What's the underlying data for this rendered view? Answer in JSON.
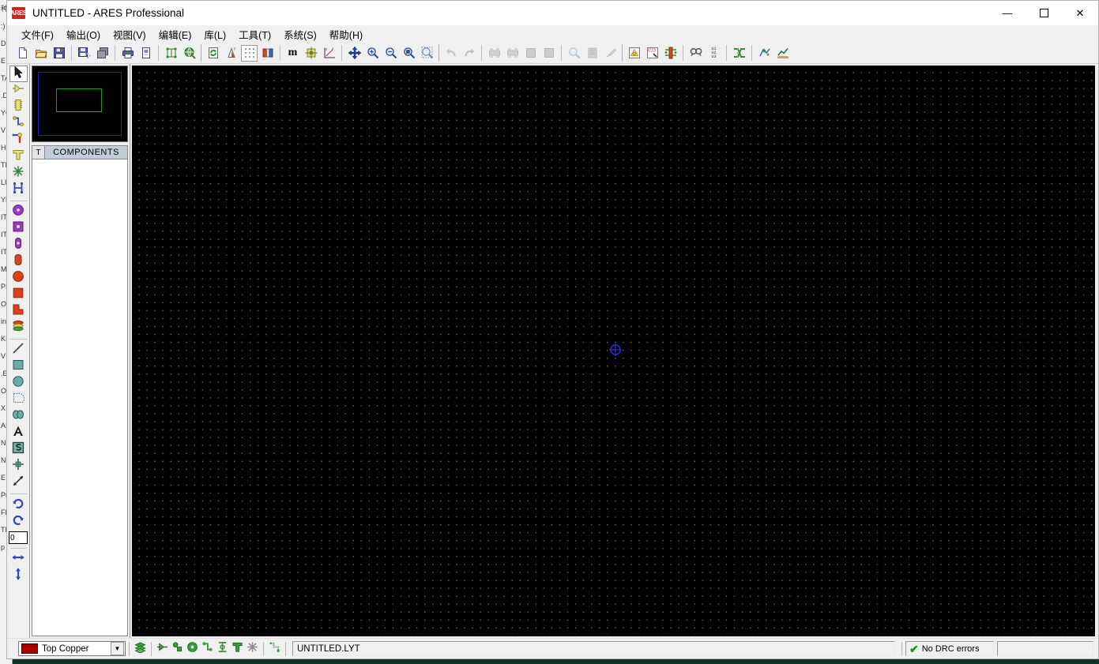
{
  "window": {
    "title": "UNTITLED - ARES Professional",
    "logo_text": "ARES",
    "logo_icon": "ares-logo-icon",
    "controls": {
      "minimize": "—",
      "maximize": "☐",
      "close": "✕"
    }
  },
  "menubar": {
    "items": [
      {
        "label": "文件(F)",
        "name": "menu-file"
      },
      {
        "label": "输出(O)",
        "name": "menu-output"
      },
      {
        "label": "视图(V)",
        "name": "menu-view"
      },
      {
        "label": "编辑(E)",
        "name": "menu-edit"
      },
      {
        "label": "库(L)",
        "name": "menu-library"
      },
      {
        "label": "工具(T)",
        "name": "menu-tools"
      },
      {
        "label": "系统(S)",
        "name": "menu-system"
      },
      {
        "label": "帮助(H)",
        "name": "menu-help"
      }
    ]
  },
  "toolbar": {
    "groups": [
      {
        "buttons": [
          {
            "icon": "new-file-icon",
            "title": "New Layout"
          },
          {
            "icon": "open-folder-icon",
            "title": "Open Layout"
          },
          {
            "icon": "save-icon",
            "title": "Save Layout"
          }
        ]
      },
      {
        "buttons": [
          {
            "icon": "import-region-icon",
            "title": "Import Region"
          },
          {
            "icon": "export-region-icon",
            "title": "Export Region"
          }
        ]
      },
      {
        "buttons": [
          {
            "icon": "print-icon",
            "title": "Print Layout"
          },
          {
            "icon": "print-region-icon",
            "title": "Print Region"
          }
        ]
      },
      {
        "buttons": [
          {
            "icon": "netlist-icon",
            "title": "Netlist Loader"
          },
          {
            "icon": "3d-visualizer-icon",
            "title": "3D Visualization"
          }
        ]
      },
      {
        "buttons": [
          {
            "icon": "refresh-icon",
            "title": "Redraw Display"
          },
          {
            "icon": "layer-select-icon",
            "title": "Toggle Layer Selector"
          },
          {
            "icon": "grid-dots-icon",
            "title": "Toggle Grid",
            "active": true
          },
          {
            "icon": "layers-icon",
            "title": "Layer Colours"
          }
        ]
      },
      {
        "buttons": [
          {
            "icon": "metric-icon",
            "title": "Toggle Metric/Imperial",
            "text": "m"
          },
          {
            "icon": "origin-icon",
            "title": "Set Origin"
          },
          {
            "icon": "xy-axis-icon",
            "title": "Set False Origin"
          }
        ]
      },
      {
        "buttons": [
          {
            "icon": "pan-icon",
            "title": "Pan"
          },
          {
            "icon": "zoom-in-icon",
            "title": "Zoom In"
          },
          {
            "icon": "zoom-out-icon",
            "title": "Zoom Out"
          },
          {
            "icon": "zoom-all-icon",
            "title": "Zoom All"
          },
          {
            "icon": "zoom-area-icon",
            "title": "Zoom to Area"
          }
        ]
      },
      {
        "buttons": [
          {
            "icon": "undo-icon",
            "title": "Undo",
            "disabled": true
          },
          {
            "icon": "redo-icon",
            "title": "Redo",
            "disabled": true
          }
        ]
      },
      {
        "buttons": [
          {
            "icon": "cut-icon",
            "title": "Cut to Clipboard",
            "disabled": true
          },
          {
            "icon": "copy-icon",
            "title": "Copy to Clipboard",
            "disabled": true
          },
          {
            "icon": "paste-icon",
            "title": "Paste from Clipboard",
            "disabled": true
          },
          {
            "icon": "block-copy-icon",
            "title": "Block Copy",
            "disabled": true
          }
        ]
      },
      {
        "buttons": [
          {
            "icon": "block-move-icon",
            "title": "Block Move",
            "disabled": true
          },
          {
            "icon": "block-rotate-icon",
            "title": "Block Rotate",
            "disabled": true
          },
          {
            "icon": "block-delete-icon",
            "title": "Block Delete",
            "disabled": true
          }
        ]
      },
      {
        "buttons": [
          {
            "icon": "autoplace-icon",
            "title": "Auto Placer"
          },
          {
            "icon": "autoroute-icon",
            "title": "Auto Router"
          },
          {
            "icon": "power-plane-icon",
            "title": "Power Plane Generator"
          }
        ]
      },
      {
        "buttons": [
          {
            "icon": "search-icon",
            "title": "Search and Tag"
          },
          {
            "icon": "auto-name-icon",
            "title": "Auto Name Generator"
          }
        ]
      },
      {
        "buttons": [
          {
            "icon": "netlist-compiler-icon",
            "title": "Netlist Compiler"
          }
        ]
      },
      {
        "buttons": [
          {
            "icon": "drc-icon",
            "title": "Design Rule Manager"
          },
          {
            "icon": "report-icon",
            "title": "Connectivity Report"
          }
        ]
      }
    ]
  },
  "tool_palette": {
    "tools": [
      {
        "name": "selection-tool",
        "icon": "arrow-cursor-icon",
        "selected": true
      },
      {
        "name": "component-tool",
        "icon": "component-arrow-icon"
      },
      {
        "name": "package-tool",
        "icon": "dip-package-icon"
      },
      {
        "name": "track-tool",
        "icon": "track-path-icon"
      },
      {
        "name": "via-tool",
        "icon": "via-pin-icon"
      },
      {
        "name": "zone-tool",
        "icon": "t-shape-icon"
      },
      {
        "name": "ratsnest-tool",
        "icon": "ratsnest-star-icon"
      },
      {
        "name": "connectivity-tool",
        "icon": "connectivity-h-icon"
      },
      {
        "sep": true
      },
      {
        "name": "round-through-pad-tool",
        "icon": "round-pad-icon"
      },
      {
        "name": "square-through-pad-tool",
        "icon": "square-pad-icon"
      },
      {
        "name": "dil-pad-tool",
        "icon": "dil-pad-icon"
      },
      {
        "name": "edge-pad-tool",
        "icon": "edge-pad-icon"
      },
      {
        "name": "smt-round-pad-tool",
        "icon": "smt-round-pad-icon"
      },
      {
        "name": "smt-square-pad-tool",
        "icon": "smt-square-pad-icon"
      },
      {
        "name": "smt-poly-pad-tool",
        "icon": "poly-pad-icon"
      },
      {
        "name": "pad-stack-tool",
        "icon": "pad-stack-icon"
      },
      {
        "sep": true
      },
      {
        "name": "line-tool",
        "icon": "line-icon"
      },
      {
        "name": "rectangle-tool",
        "icon": "rectangle-icon"
      },
      {
        "name": "circle-tool",
        "icon": "circle-icon"
      },
      {
        "name": "arc-tool",
        "icon": "arc-icon"
      },
      {
        "name": "path-tool",
        "icon": "closed-path-icon"
      },
      {
        "name": "text-tool",
        "icon": "text-a-icon"
      },
      {
        "name": "symbol-tool",
        "icon": "symbol-s-icon"
      },
      {
        "name": "marker-tool",
        "icon": "marker-cross-icon"
      },
      {
        "name": "dimension-tool",
        "icon": "dimension-arrow-icon"
      },
      {
        "sep": true
      },
      {
        "name": "rotate-clockwise",
        "icon": "rotate-cw-icon"
      },
      {
        "name": "rotate-anticlockwise",
        "icon": "rotate-ccw-icon"
      },
      {
        "name": "rotation-value-input",
        "icon": "rotation-field",
        "value": "0"
      },
      {
        "sep": true
      },
      {
        "name": "mirror-horizontal",
        "icon": "flip-horizontal-icon"
      },
      {
        "name": "mirror-vertical",
        "icon": "flip-vertical-icon"
      }
    ],
    "rotation_value": "0"
  },
  "left_panel": {
    "preview": {
      "name": "component-preview",
      "board_outline_color": "#2222bb",
      "part_outline_color": "#23a023",
      "background_color": "#000000"
    },
    "components_header": {
      "toggle_label": "T",
      "title": "COMPONENTS"
    },
    "components_list": []
  },
  "canvas": {
    "background_color": "#000000",
    "grid_dot_color": "#787878",
    "origin_marker_color": "#2222cc",
    "origin_icon": "origin-crosshair-icon"
  },
  "statusbar": {
    "layer": {
      "name": "Top Copper",
      "color": "#aa0000",
      "arrow": "▼"
    },
    "buttons": [
      {
        "name": "layer-stack-button",
        "icon": "layer-stack-icon"
      },
      {
        "sep": true
      },
      {
        "name": "display-components-button",
        "icon": "display-component-icon"
      },
      {
        "name": "display-pads-button",
        "icon": "display-pads-icon"
      },
      {
        "name": "display-vias-button",
        "icon": "display-via-icon"
      },
      {
        "name": "display-tracks-button",
        "icon": "display-track-icon"
      },
      {
        "name": "display-zones-button",
        "icon": "display-zone-icon"
      },
      {
        "name": "display-text-button",
        "icon": "display-text-icon"
      },
      {
        "name": "display-ratsnest-button",
        "icon": "display-ratsnest-icon"
      },
      {
        "sep": true
      },
      {
        "name": "display-drill-button",
        "icon": "display-drill-icon"
      }
    ],
    "filename": "UNTITLED.LYT",
    "drc": {
      "text": "No DRC errors",
      "icon": "green-check-icon",
      "color": "#00a000"
    },
    "coordinates": ""
  },
  "background_window": {
    "lines": [
      "种",
      ":)",
      "D",
      "E",
      "TA",
      ".D",
      "YC",
      "V",
      "HI",
      "TR",
      "LU",
      "YR",
      "IT",
      "IT",
      "IT",
      "MD",
      "PI",
      "OL",
      "in",
      "KI",
      "V",
      ".E",
      "OL",
      "X",
      "AI",
      "NC",
      "NC",
      "E",
      "Pr",
      "FN",
      "TF",
      "p"
    ]
  }
}
